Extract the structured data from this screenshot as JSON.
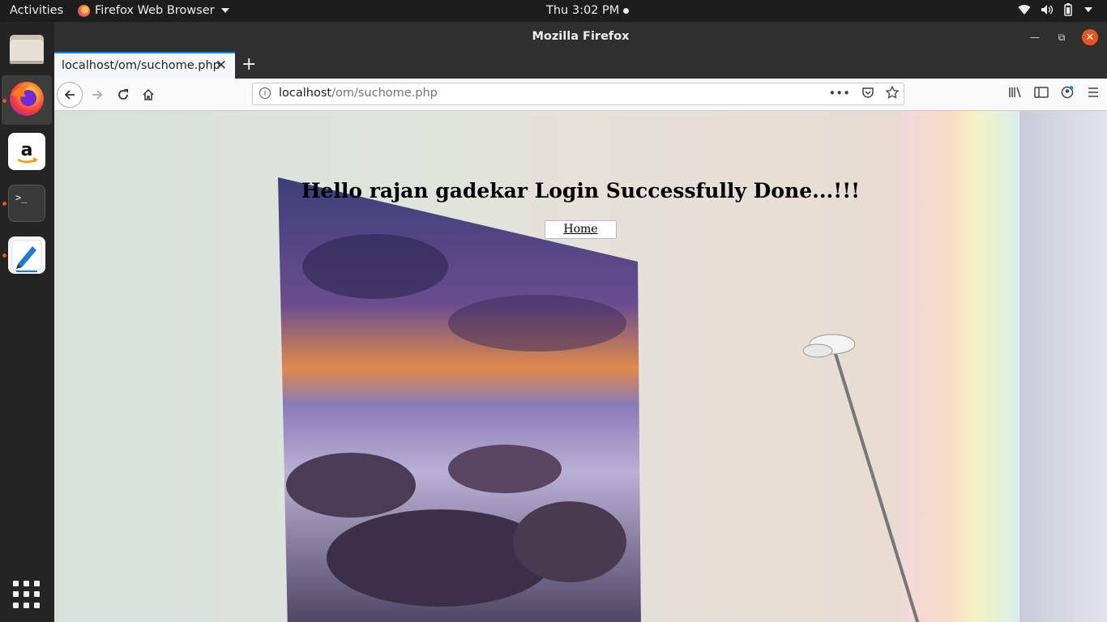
{
  "topbar": {
    "activities": "Activities",
    "app_name": "Firefox Web Browser",
    "clock": "Thu  3:02 PM"
  },
  "dock": {
    "items": [
      {
        "name": "files",
        "icon": "files-icon"
      },
      {
        "name": "firefox",
        "icon": "firefox-icon"
      },
      {
        "name": "amazon",
        "icon": "amazon-icon"
      },
      {
        "name": "terminal",
        "icon": "terminal-icon"
      },
      {
        "name": "text-editor",
        "icon": "text-editor-icon"
      }
    ]
  },
  "window": {
    "title": "Mozilla Firefox"
  },
  "tab": {
    "label": "localhost/om/suchome.php"
  },
  "urlbar": {
    "host": "localhost",
    "path": "/om/suchome.php"
  },
  "page": {
    "greeting": "Hello rajan gadekar Login Successfully Done...!!!",
    "home_button": "Home"
  },
  "colors": {
    "accent": "#e95420",
    "tab_highlight": "#0a84ff"
  }
}
